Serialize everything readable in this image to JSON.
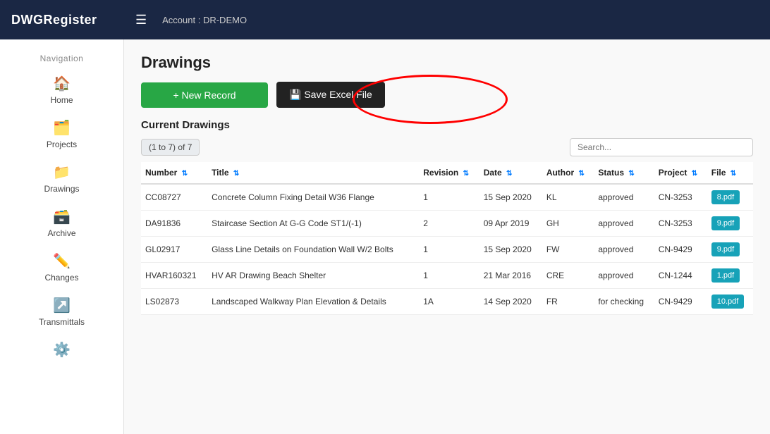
{
  "topbar": {
    "logo": "DWGRegister",
    "account_label": "Account : DR-DEMO"
  },
  "sidebar": {
    "nav_label": "Navigation",
    "items": [
      {
        "id": "home",
        "label": "Home",
        "icon": "🏠"
      },
      {
        "id": "projects",
        "label": "Projects",
        "icon": "🗂️"
      },
      {
        "id": "drawings",
        "label": "Drawings",
        "icon": "📁"
      },
      {
        "id": "archive",
        "label": "Archive",
        "icon": "🗃️"
      },
      {
        "id": "changes",
        "label": "Changes",
        "icon": "✏️"
      },
      {
        "id": "transmittals",
        "label": "Transmittals",
        "icon": "↗️"
      },
      {
        "id": "settings",
        "label": "",
        "icon": "⚙️"
      }
    ]
  },
  "main": {
    "page_title": "Drawings",
    "toolbar": {
      "new_record_label": "+ New Record",
      "save_excel_label": "💾 Save Excel File"
    },
    "section_title": "Current Drawings",
    "record_count": "(1 to 7) of 7",
    "search_placeholder": "Search...",
    "table": {
      "columns": [
        "Number",
        "Title",
        "Revision",
        "Date",
        "Author",
        "Status",
        "Project",
        "File"
      ],
      "rows": [
        {
          "number": "CC08727",
          "title": "Concrete Column Fixing Detail W36 Flange",
          "revision": "1",
          "date": "15 Sep 2020",
          "author": "KL",
          "status": "approved",
          "project": "CN-3253",
          "file": "8.pdf"
        },
        {
          "number": "DA91836",
          "title": "Staircase Section At G-G Code ST1/(-1)",
          "revision": "2",
          "date": "09 Apr 2019",
          "author": "GH",
          "status": "approved",
          "project": "CN-3253",
          "file": "9.pdf"
        },
        {
          "number": "GL02917",
          "title": "Glass Line Details on Foundation Wall W/2 Bolts",
          "revision": "1",
          "date": "15 Sep 2020",
          "author": "FW",
          "status": "approved",
          "project": "CN-9429",
          "file": "9.pdf"
        },
        {
          "number": "HVAR160321",
          "title": "HV AR Drawing Beach Shelter",
          "revision": "1",
          "date": "21 Mar 2016",
          "author": "CRE",
          "status": "approved",
          "project": "CN-1244",
          "file": "1.pdf"
        },
        {
          "number": "LS02873",
          "title": "Landscaped Walkway Plan Elevation & Details",
          "revision": "1A",
          "date": "14 Sep 2020",
          "author": "FR",
          "status": "for checking",
          "project": "CN-9429",
          "file": "10.pdf"
        }
      ]
    }
  }
}
